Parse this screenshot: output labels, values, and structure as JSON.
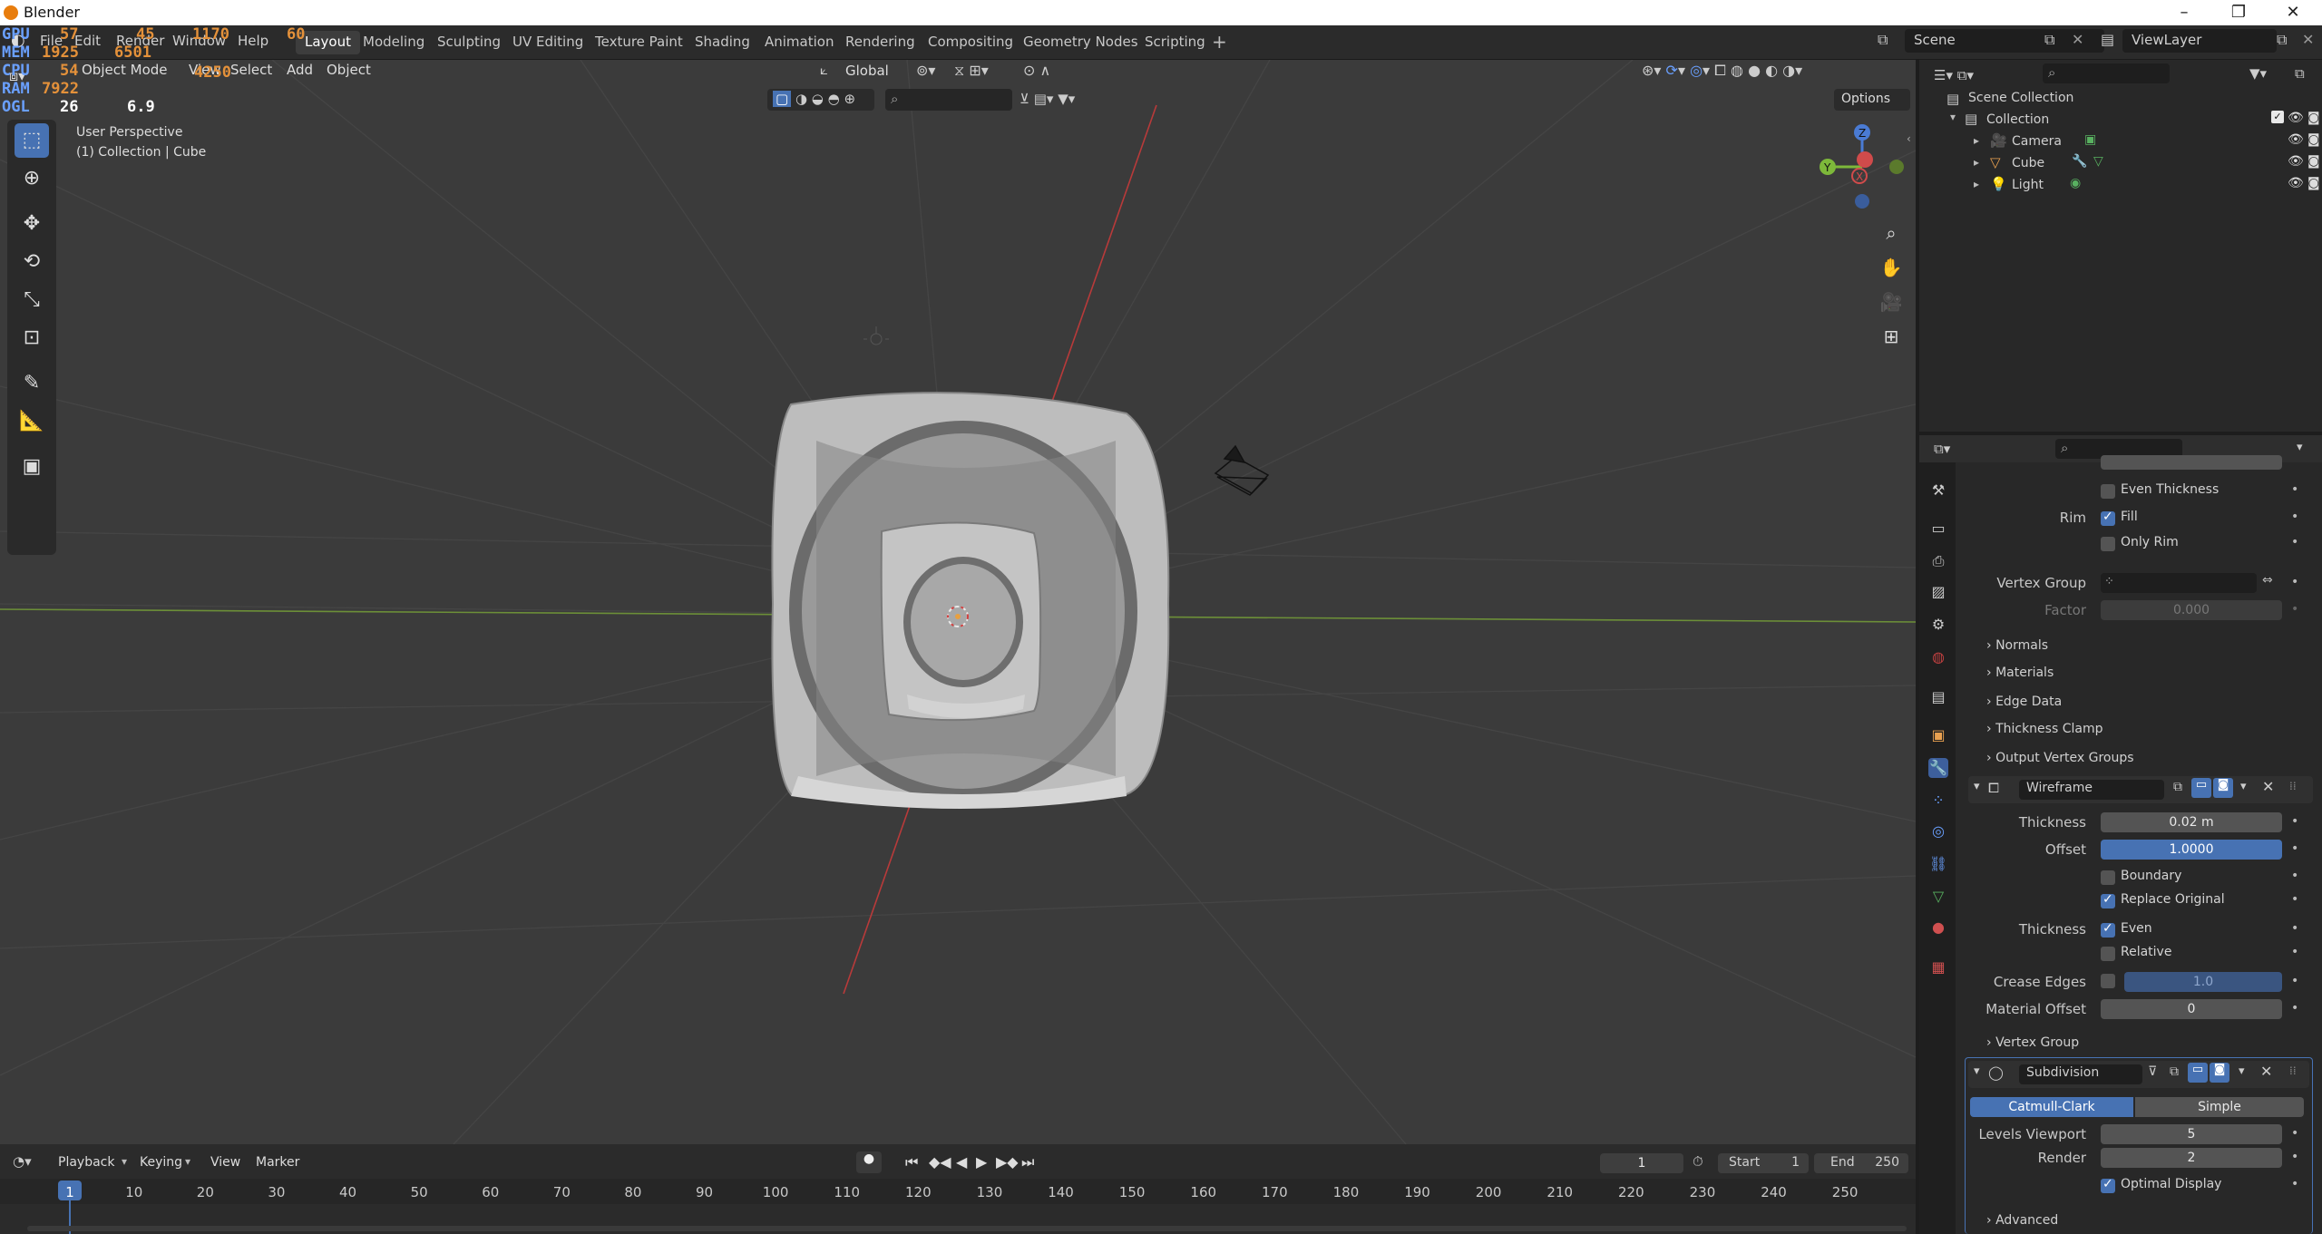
{
  "window": {
    "title": "Blender"
  },
  "menu": {
    "items": [
      "File",
      "Edit",
      "Render",
      "Window",
      "Help"
    ]
  },
  "workspaces": [
    "Layout",
    "Modeling",
    "Sculpting",
    "UV Editing",
    "Texture Paint",
    "Shading",
    "Animation",
    "Rendering",
    "Compositing",
    "Geometry Nodes",
    "Scripting"
  ],
  "active_workspace": "Layout",
  "scene": {
    "name": "Scene",
    "view_layer": "ViewLayer"
  },
  "hud": {
    "gpu_label": "GPU",
    "gpu_val": "57",
    "gpu_pct": "45",
    "gpu_mhz": "1170",
    "gpu_temp": "60",
    "mem_label": "MEM",
    "mem_val": "1925",
    "mem2": "6501",
    "cpu_label": "CPU",
    "cpu_val": "54",
    "cpu2": "4250",
    "ram_label": "RAM",
    "ram_val": "7922",
    "ogl_label": "OGL",
    "ogl_fps": "26",
    "ogl_ms": "6.9"
  },
  "viewport": {
    "mode": "Object Mode",
    "menus": [
      "View",
      "Select",
      "Add",
      "Object"
    ],
    "orientation": "Global",
    "options": "Options",
    "view_name": "User Perspective",
    "collection_info": "(1) Collection | Cube"
  },
  "outliner": {
    "root": "Scene Collection",
    "collection": "Collection",
    "objects": [
      "Camera",
      "Cube",
      "Light"
    ]
  },
  "props": {
    "solidify": {
      "even_thickness": "Even Thickness",
      "rim_label": "Rim",
      "fill": "Fill",
      "only_rim": "Only Rim",
      "vertex_group": "Vertex Group",
      "factor_label": "Factor",
      "factor_val": "0.000",
      "panels": [
        "Normals",
        "Materials",
        "Edge Data",
        "Thickness Clamp",
        "Output Vertex Groups"
      ]
    },
    "wireframe": {
      "name": "Wireframe",
      "thickness_label": "Thickness",
      "thickness_val": "0.02 m",
      "offset_label": "Offset",
      "offset_val": "1.0000",
      "boundary": "Boundary",
      "replace_original": "Replace Original",
      "thickness2_label": "Thickness",
      "even": "Even",
      "relative": "Relative",
      "crease_label": "Crease Edges",
      "crease_val": "1.0",
      "material_label": "Material Offset",
      "material_val": "0",
      "vertex_group": "Vertex Group"
    },
    "subdivision": {
      "name": "Subdivision",
      "mode_a": "Catmull-Clark",
      "mode_b": "Simple",
      "levels_label": "Levels Viewport",
      "levels_val": "5",
      "render_label": "Render",
      "render_val": "2",
      "optimal": "Optimal Display",
      "advanced": "Advanced"
    }
  },
  "timeline": {
    "menus": [
      "Playback",
      "Keying",
      "View",
      "Marker"
    ],
    "current_frame": "1",
    "start_label": "Start",
    "start_val": "1",
    "end_label": "End",
    "end_val": "250",
    "ticks": [
      "1",
      "10",
      "20",
      "30",
      "40",
      "50",
      "60",
      "70",
      "80",
      "90",
      "100",
      "110",
      "120",
      "130",
      "140",
      "150",
      "160",
      "170",
      "180",
      "190",
      "200",
      "210",
      "220",
      "230",
      "240",
      "250"
    ]
  }
}
